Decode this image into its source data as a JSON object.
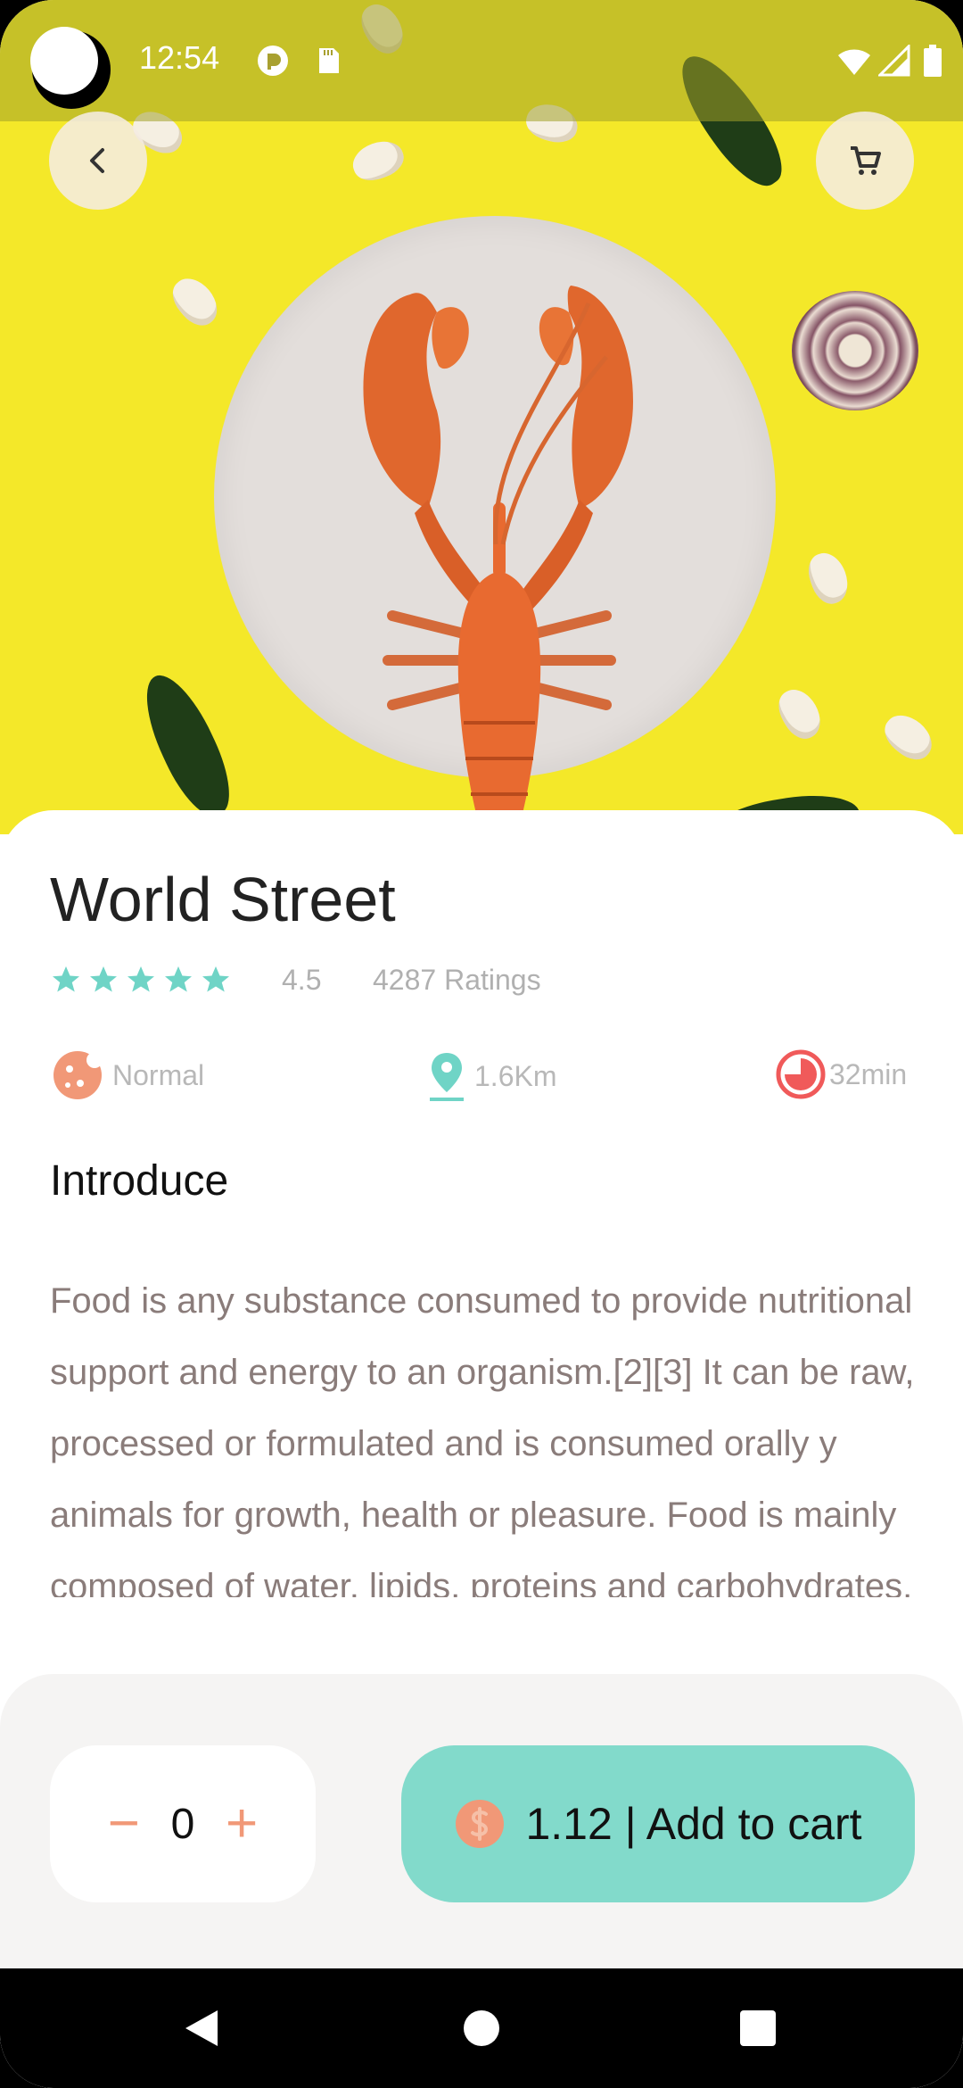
{
  "status_bar": {
    "time": "12:54"
  },
  "header": {
    "back_icon": "chevron-left-icon",
    "cart_icon": "cart-icon"
  },
  "restaurant": {
    "name": "World Street",
    "rating": "4.5",
    "ratings_count": "4287 Ratings",
    "stars": 5
  },
  "info": [
    {
      "icon": "cookie-icon",
      "label": "Normal"
    },
    {
      "icon": "location-pin-icon",
      "label": "1.6Km"
    },
    {
      "icon": "timer-icon",
      "label": "32min"
    }
  ],
  "section": {
    "title": "Introduce"
  },
  "description": "Food is any substance consumed to provide nutritional support and energy to an organism.[2][3] It can be raw, processed or formulated and is consumed orally y animals for growth, health or pleasure. Food is mainly composed of water, lipids, proteins and carbohydrates. Minerals (e.g.",
  "order": {
    "minus": "−",
    "plus": "+",
    "quantity": "0",
    "add_to_cart_label": "1.12 | Add to cart"
  },
  "colors": {
    "accent_teal": "#82dacb",
    "accent_orange": "#f19877",
    "star": "#6fd4c6",
    "hero_bg": "#f4e829"
  }
}
